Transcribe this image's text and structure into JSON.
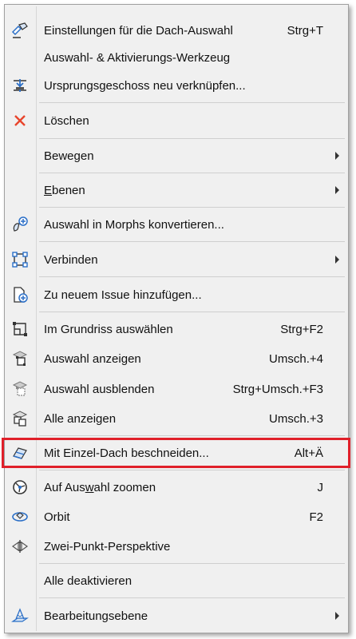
{
  "menu": {
    "items": [
      {
        "label": "Einstellungen für die Dach-Auswahl",
        "shortcut": "Strg+T",
        "icon": "roof-settings-icon"
      },
      {
        "label": "Auswahl- & Aktivierungs-Werkzeug",
        "shortcut": "",
        "icon": ""
      },
      {
        "label": "Ursprungsgeschoss neu verknüpfen...",
        "shortcut": "",
        "icon": "story-link-icon"
      },
      {
        "label": "Löschen",
        "shortcut": "",
        "icon": "delete-x-icon"
      },
      {
        "label": "Bewegen",
        "shortcut": "",
        "submenu": true
      },
      {
        "label": "Ebenen",
        "shortcut": "",
        "submenu": true
      },
      {
        "label": "Auswahl in Morphs konvertieren...",
        "shortcut": "",
        "icon": "morph-convert-icon"
      },
      {
        "label": "Verbinden",
        "shortcut": "",
        "icon": "connect-icon",
        "submenu": true
      },
      {
        "label": "Zu neuem Issue hinzufügen...",
        "shortcut": "",
        "icon": "add-issue-icon"
      },
      {
        "label": "Im Grundriss auswählen",
        "shortcut": "Strg+F2",
        "icon": "select-floorplan-icon"
      },
      {
        "label": "Auswahl anzeigen",
        "shortcut": "Umsch.+4",
        "icon": "show-selection-icon"
      },
      {
        "label": "Auswahl ausblenden",
        "shortcut": "Strg+Umsch.+F3",
        "icon": "hide-selection-icon"
      },
      {
        "label": "Alle anzeigen",
        "shortcut": "Umsch.+3",
        "icon": "show-all-icon"
      },
      {
        "label": "Mit Einzel-Dach beschneiden...",
        "shortcut": "Alt+Ä",
        "icon": "trim-roof-icon"
      },
      {
        "label": "Auf Auswahl zoomen",
        "shortcut": "J",
        "icon": "zoom-selection-icon"
      },
      {
        "label": "Orbit",
        "shortcut": "F2",
        "icon": "orbit-icon"
      },
      {
        "label": "Zwei-Punkt-Perspektive",
        "shortcut": "",
        "icon": "two-point-perspective-icon"
      },
      {
        "label": "Alle deaktivieren",
        "shortcut": "",
        "icon": ""
      },
      {
        "label": "Bearbeitungsebene",
        "shortcut": "",
        "icon": "editing-plane-icon",
        "submenu": true
      }
    ]
  },
  "colors": {
    "highlight_border": "#e0202a",
    "menu_bg": "#f0f0f0",
    "delete_red": "#e8452c",
    "icon_blue": "#2b6fc7"
  }
}
